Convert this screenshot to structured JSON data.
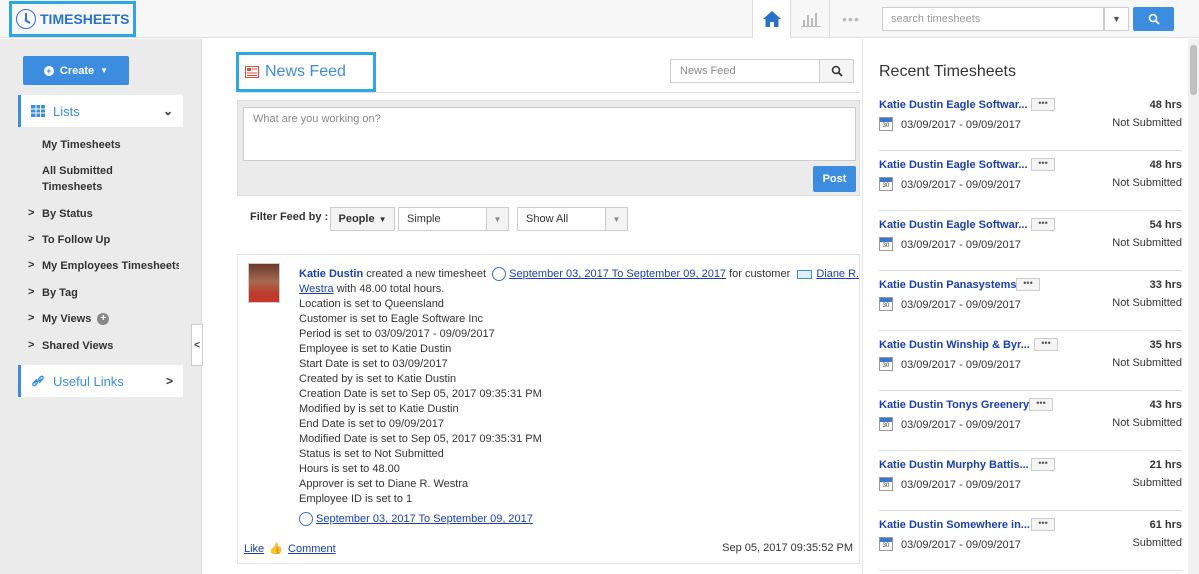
{
  "app": {
    "title": "TIMESHEETS"
  },
  "topbar": {
    "search_placeholder": "search timesheets",
    "more_label": "•••"
  },
  "sidebar": {
    "create_label": "Create",
    "lists_label": "Lists",
    "links": [
      "My Timesheets",
      "All Submitted Timesheets"
    ],
    "groups": [
      "By Status",
      "To Follow Up",
      "My Employees Timesheets",
      "By Tag",
      "My Views",
      "Shared Views"
    ],
    "useful_links_label": "Useful Links"
  },
  "main": {
    "title": "News Feed",
    "feed_search_placeholder": "News Feed",
    "post_placeholder": "What are you working on?",
    "post_label": "Post",
    "filter_label": "Filter Feed by :",
    "filter_people": "People",
    "filter_type": "Simple",
    "filter_show": "Show All"
  },
  "feed_item": {
    "author": "Katie Dustin",
    "action": " created a new timesheet ",
    "timesheet_link": "September 03, 2017 To September 09, 2017",
    "for_customer": " for customer ",
    "customer_link_1": "Diane R.",
    "customer_link_2": "Westra",
    "with_hours": " with 48.00 total hours.",
    "details": [
      "Location is set to Queensland",
      "Customer is set to Eagle Software Inc",
      "Period is set to 03/09/2017 - 09/09/2017",
      "Employee is set to Katie Dustin",
      "Start Date is set to 03/09/2017",
      "Created by is set to Katie Dustin",
      "Creation Date is set to Sep 05, 2017 09:35:31 PM",
      "Modified by is set to Katie Dustin",
      "End Date is set to 09/09/2017",
      "Modified Date is set to Sep 05, 2017 09:35:31 PM",
      "Status is set to Not Submitted",
      "Hours is set to 48.00",
      "Approver is set to Diane R. Westra",
      "Employee ID is set to 1"
    ],
    "bottom_link": "September 03, 2017 To September 09, 2017",
    "like_label": "Like",
    "comment_label": "Comment",
    "timestamp": "Sep 05, 2017 09:35:52 PM"
  },
  "recent": {
    "title": "Recent Timesheets",
    "calendar_day": "30",
    "items": [
      {
        "name": "Katie Dustin Eagle Softwar...",
        "hours": "48 hrs",
        "range": "03/09/2017 - 09/09/2017",
        "status": "Not Submitted"
      },
      {
        "name": "Katie Dustin Eagle Softwar...",
        "hours": "48 hrs",
        "range": "03/09/2017 - 09/09/2017",
        "status": "Not Submitted"
      },
      {
        "name": "Katie Dustin Eagle Softwar...",
        "hours": "54 hrs",
        "range": "03/09/2017 - 09/09/2017",
        "status": "Not Submitted"
      },
      {
        "name": "Katie Dustin Panasystems",
        "hours": "33 hrs",
        "range": "03/09/2017 - 09/09/2017",
        "status": "Not Submitted"
      },
      {
        "name": "Katie Dustin Winship & Byr...",
        "hours": "35 hrs",
        "range": "03/09/2017 - 09/09/2017",
        "status": "Not Submitted"
      },
      {
        "name": "Katie Dustin Tonys Greenery",
        "hours": "43 hrs",
        "range": "03/09/2017 - 09/09/2017",
        "status": "Not Submitted"
      },
      {
        "name": "Katie Dustin Murphy Battis...",
        "hours": "21 hrs",
        "range": "03/09/2017 - 09/09/2017",
        "status": "Submitted"
      },
      {
        "name": "Katie Dustin Somewhere in...",
        "hours": "61 hrs",
        "range": "03/09/2017 - 09/09/2017",
        "status": "Submitted"
      }
    ]
  },
  "colors": {
    "accent": "#3c8ddf",
    "highlight": "#2ea8e0",
    "link": "#1a3fb0"
  }
}
